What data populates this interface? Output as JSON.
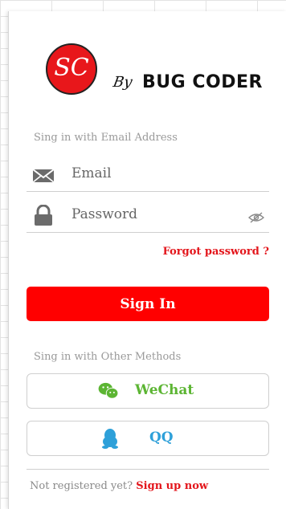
{
  "logo": {
    "initials": "SC",
    "by": "By",
    "brand": "BUG CODER",
    "circle_color": "#e8171b"
  },
  "email_section": {
    "label": "Sing in with Email Address"
  },
  "email_field": {
    "placeholder": "Email",
    "icon": "envelope-icon"
  },
  "password_field": {
    "placeholder": "Password",
    "icon": "lock-icon",
    "toggle_icon": "eye-off-icon"
  },
  "forgot_password": "Forgot password ?",
  "sign_in_button": {
    "label": "Sign In",
    "color": "#ff0000"
  },
  "other_section": {
    "label": "Sing in with Other Methods"
  },
  "wechat_button": {
    "label": "WeChat",
    "icon": "wechat-icon",
    "color": "#5cb533"
  },
  "qq_button": {
    "label": "QQ",
    "icon": "qq-penguin-icon",
    "color": "#2ea0d9"
  },
  "register": {
    "question": "Not  registered yet?",
    "link": "Sign up now"
  }
}
